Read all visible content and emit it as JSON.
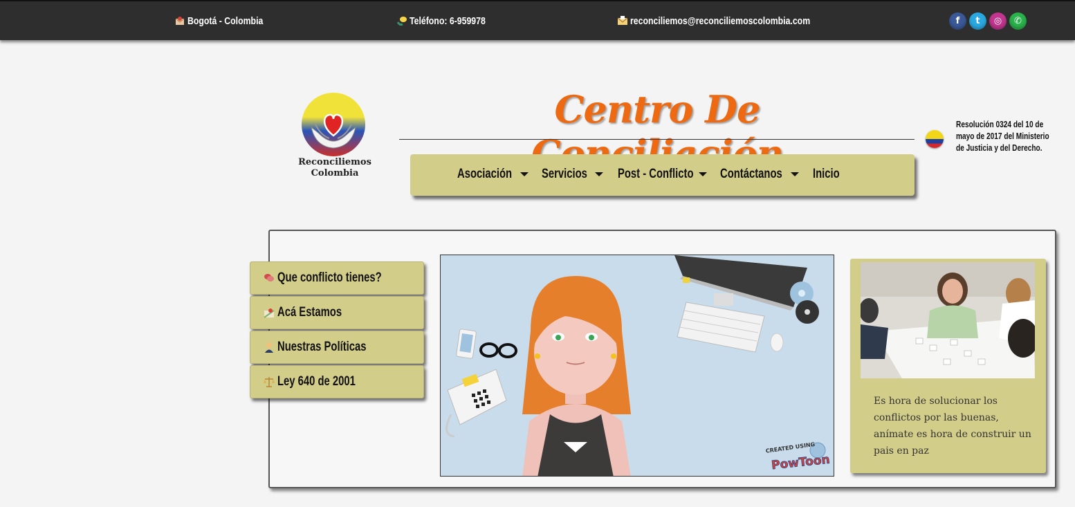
{
  "topbar": {
    "location": "Bogotá - Colombia",
    "phone": "Teléfono: 6-959978",
    "email": "reconciliemos@reconciliemoscolombia.com",
    "social": [
      {
        "name": "facebook-icon",
        "glyph": "f",
        "color": "#3b5998"
      },
      {
        "name": "twitter-icon",
        "glyph": "t",
        "color": "#2aa9e0"
      },
      {
        "name": "instagram-icon",
        "glyph": "◎",
        "color": "#c2368f"
      },
      {
        "name": "whatsapp-icon",
        "glyph": "✆",
        "color": "#2bb24c"
      }
    ]
  },
  "logo": {
    "line1": "Reconciliemos",
    "line2": "Colombia"
  },
  "header": {
    "title": "Centro De Conciliación"
  },
  "nav": {
    "items": [
      {
        "label": "Asociación",
        "dropdown": true
      },
      {
        "label": "Servicios",
        "dropdown": true
      },
      {
        "label": "Post - Conflicto",
        "dropdown": true
      },
      {
        "label": "Contáctanos",
        "dropdown": true
      },
      {
        "label": "Inicio",
        "dropdown": false
      }
    ]
  },
  "resolution": {
    "line1": "Resolución 0324 del 10 de",
    "line2": "mayo de 2017 del Ministerio",
    "line3": "de Justicia y del Derecho."
  },
  "sidebar": {
    "items": [
      {
        "label": "Que conflicto tienes?",
        "icon": "chat-bubbles-icon"
      },
      {
        "label": "Acá Estamos",
        "icon": "map-icon"
      },
      {
        "label": "Nuestras Políticas",
        "icon": "person-icon"
      },
      {
        "label": "Ley 640 de 2001",
        "icon": "scales-icon"
      }
    ]
  },
  "video": {
    "watermark_top": "CREATED USING",
    "watermark_brand": "PowToon"
  },
  "card": {
    "text": "Es hora de solucionar los conflictos por las buenas, anímate es hora de construir un pais en paz"
  },
  "colors": {
    "topbar": "#2e2e2e",
    "accent": "#ee6a12",
    "khaki": "#d3cd8a",
    "background": "#f4f4f4"
  }
}
